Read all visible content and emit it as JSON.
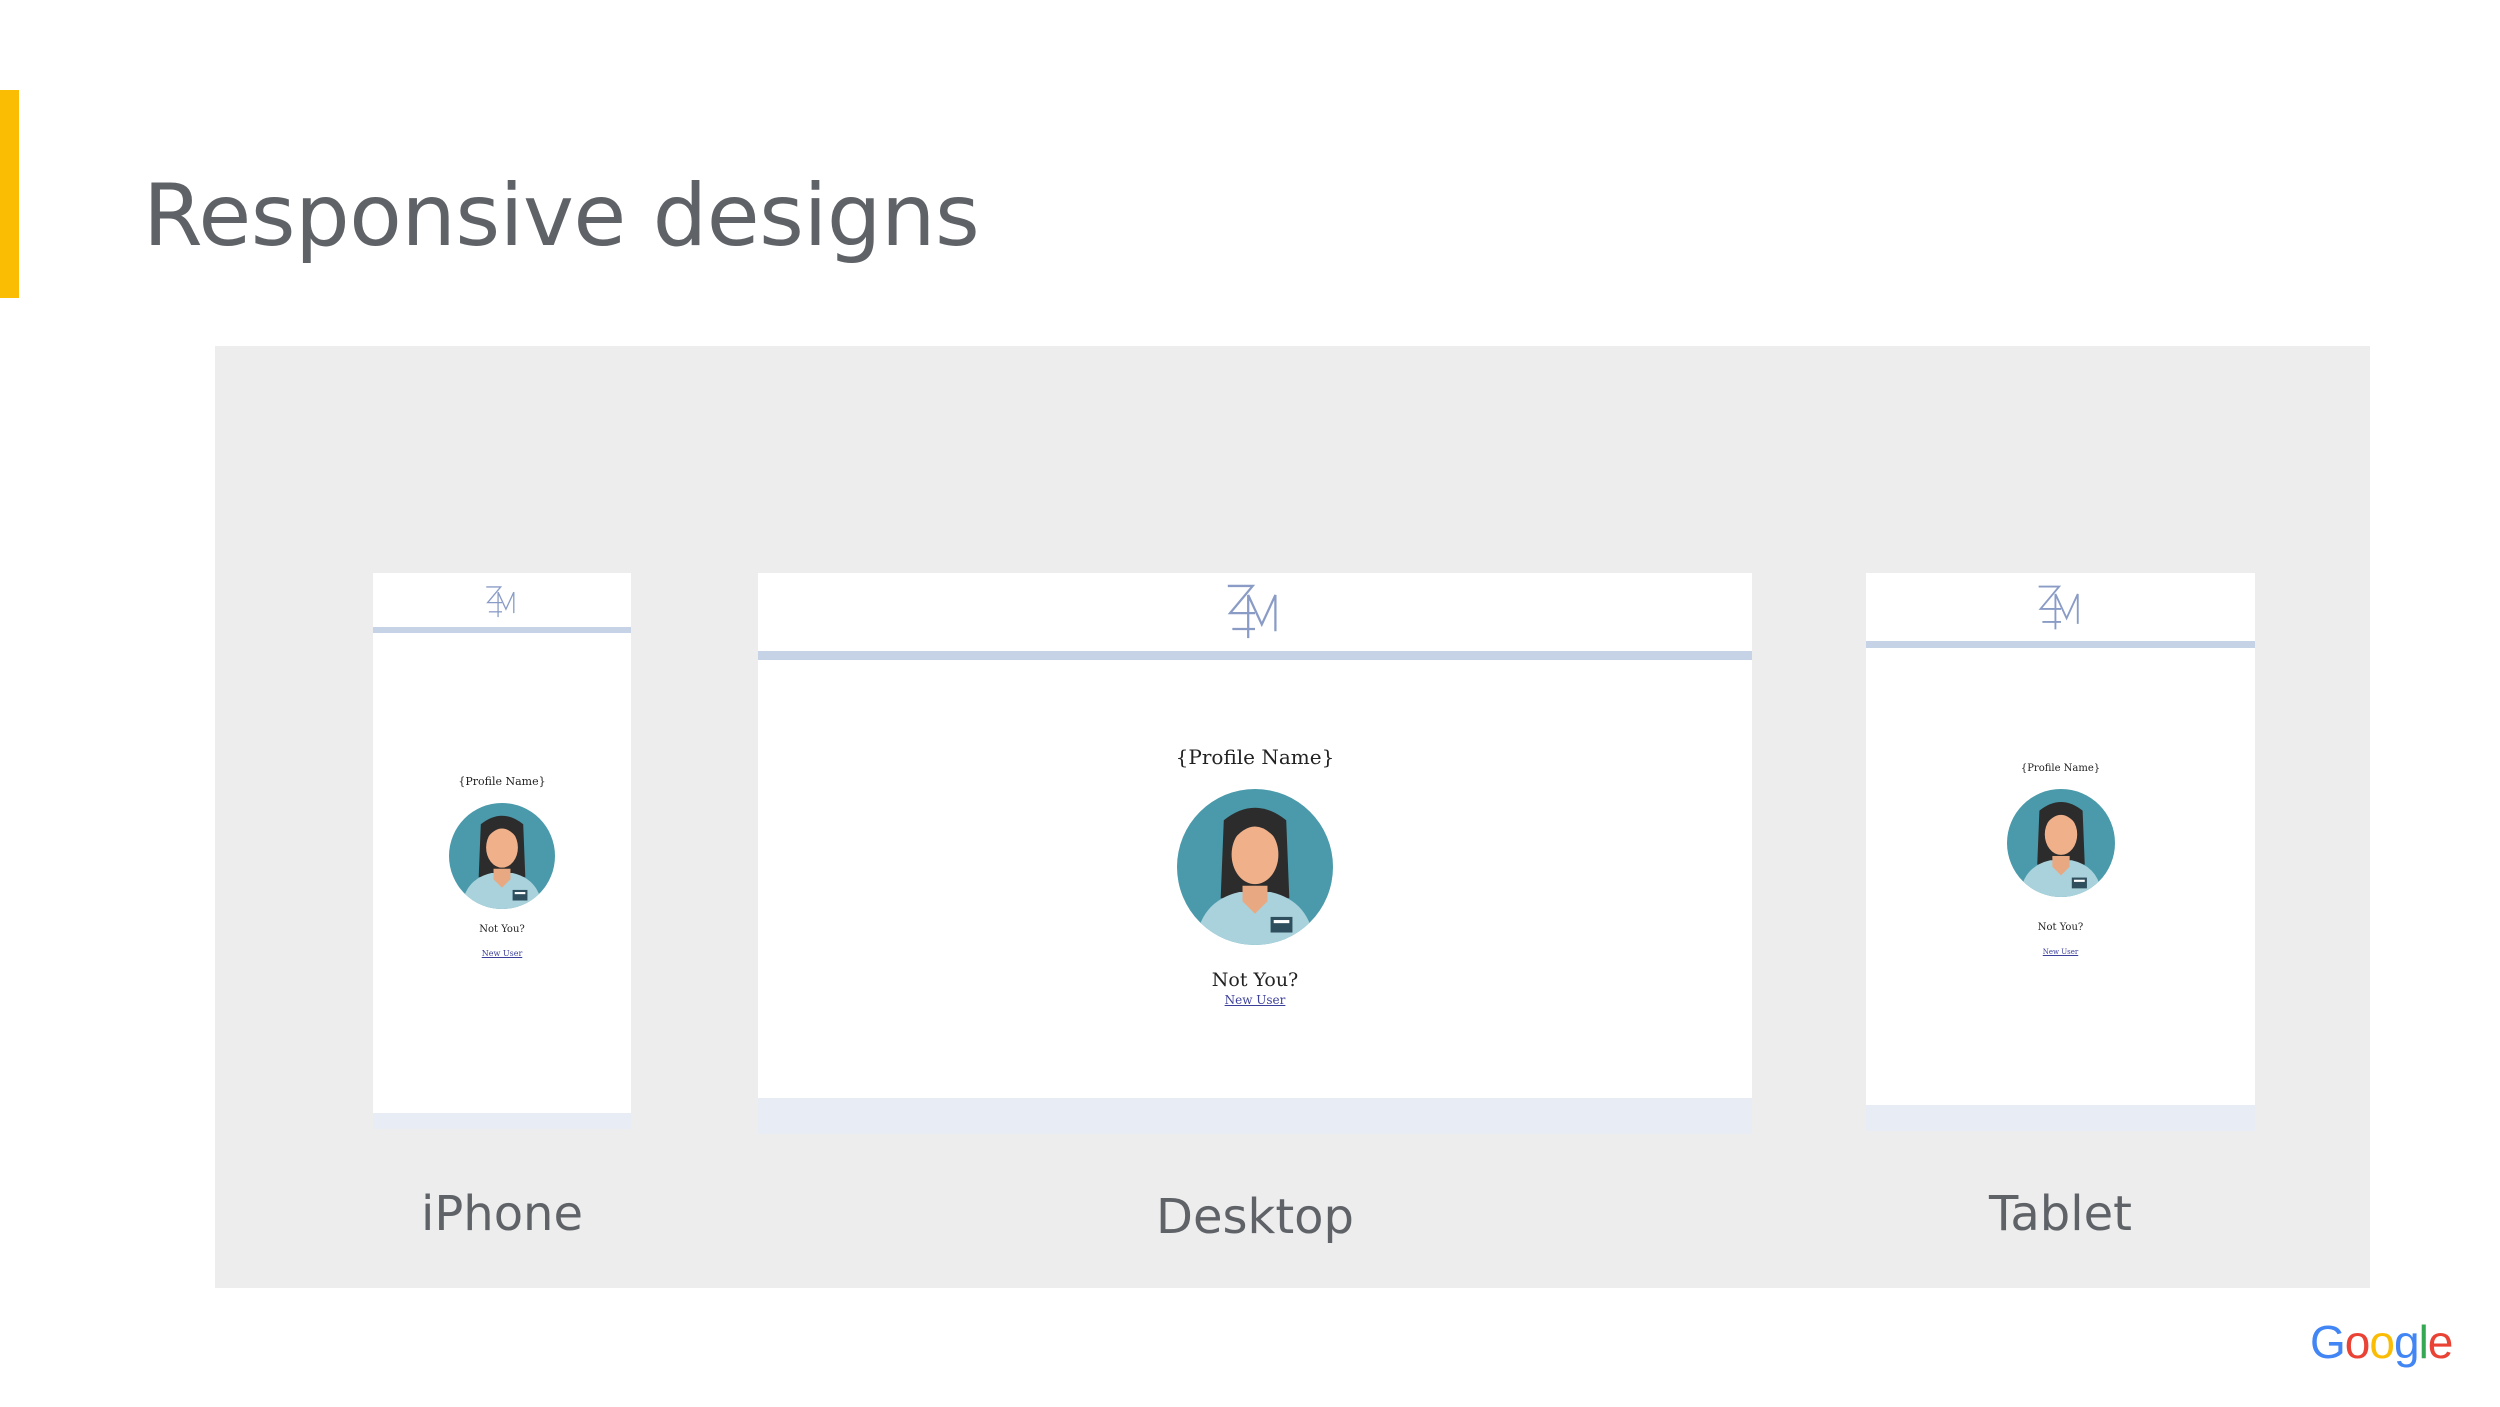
{
  "slide": {
    "title": "Responsive designs"
  },
  "colors": {
    "accent": "#FBBC04",
    "title_text": "#5f6368",
    "showcase_bg": "#ededed",
    "header_rule": "#c6d3e6",
    "avatar_bg": "#4a9aab"
  },
  "devices": [
    {
      "label": "iPhone",
      "profile_name": "{Profile Name}",
      "not_you": "Not You?",
      "new_user": "New User"
    },
    {
      "label": "Desktop",
      "profile_name": "{Profile Name}",
      "not_you": "Not You?",
      "new_user": "New User"
    },
    {
      "label": "Tablet",
      "profile_name": "{Profile Name}",
      "not_you": "Not You?",
      "new_user": "New User"
    }
  ],
  "branding": {
    "google_letters": [
      "G",
      "o",
      "o",
      "g",
      "l",
      "e"
    ],
    "google_colors": [
      "#4285F4",
      "#EA4335",
      "#FBBC05",
      "#4285F4",
      "#34A853",
      "#EA4335"
    ]
  }
}
